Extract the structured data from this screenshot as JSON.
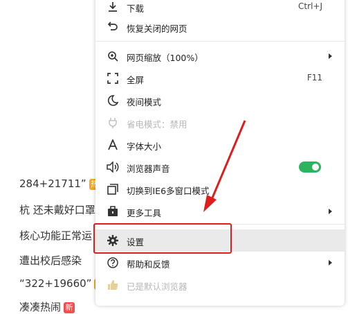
{
  "background": {
    "lines": [
      {
        "text": "284+21711”",
        "badge": "热",
        "badge_color": "#f5a623"
      },
      {
        "text": "杭 还未戴好口罩",
        "badge": "",
        "badge_color": ""
      },
      {
        "text": "核心功能正常运",
        "badge": "",
        "badge_color": ""
      },
      {
        "text": "遭出校后感染",
        "badge": "",
        "badge_color": ""
      },
      {
        "text": "“322+19660”",
        "badge": "热",
        "badge_color": "#f5a623"
      },
      {
        "text": "凑凑热闹",
        "badge": "新",
        "badge_color": "#ef4f4f"
      }
    ]
  },
  "menu": {
    "items": [
      {
        "label": "下载",
        "shortcut": "Ctrl+J",
        "icon": "download-icon"
      },
      {
        "label": "恢复关闭的网页",
        "shortcut": "",
        "icon": "undo-icon"
      },
      {
        "label": "网页缩放（100%）",
        "shortcut": "",
        "icon": "zoom-icon"
      },
      {
        "label": "全屏",
        "shortcut": "F11",
        "icon": "fullscreen-icon"
      },
      {
        "label": "夜间模式",
        "shortcut": "",
        "icon": "moon-icon"
      },
      {
        "label": "省电模式：禁用",
        "shortcut": "",
        "icon": "plug-icon"
      },
      {
        "label": "字体大小",
        "shortcut": "",
        "icon": "font-icon"
      },
      {
        "label": "浏览器声音",
        "shortcut": "",
        "icon": "speaker-icon",
        "toggle_on": true
      },
      {
        "label": "切换到IE6多窗口模式",
        "shortcut": "",
        "icon": "windows-icon"
      },
      {
        "label": "更多工具",
        "shortcut": "",
        "icon": "toolbox-icon"
      },
      {
        "label": "设置",
        "shortcut": "",
        "icon": "gear-icon"
      },
      {
        "label": "帮助和反馈",
        "shortcut": "",
        "icon": "help-icon"
      },
      {
        "label": "已是默认浏览器",
        "shortcut": "",
        "icon": "thumbs-up-icon"
      }
    ]
  },
  "colors": {
    "accent_red": "#e01d1d",
    "toggle_green": "#2cb45e",
    "hot_badge": "#f5a623"
  }
}
